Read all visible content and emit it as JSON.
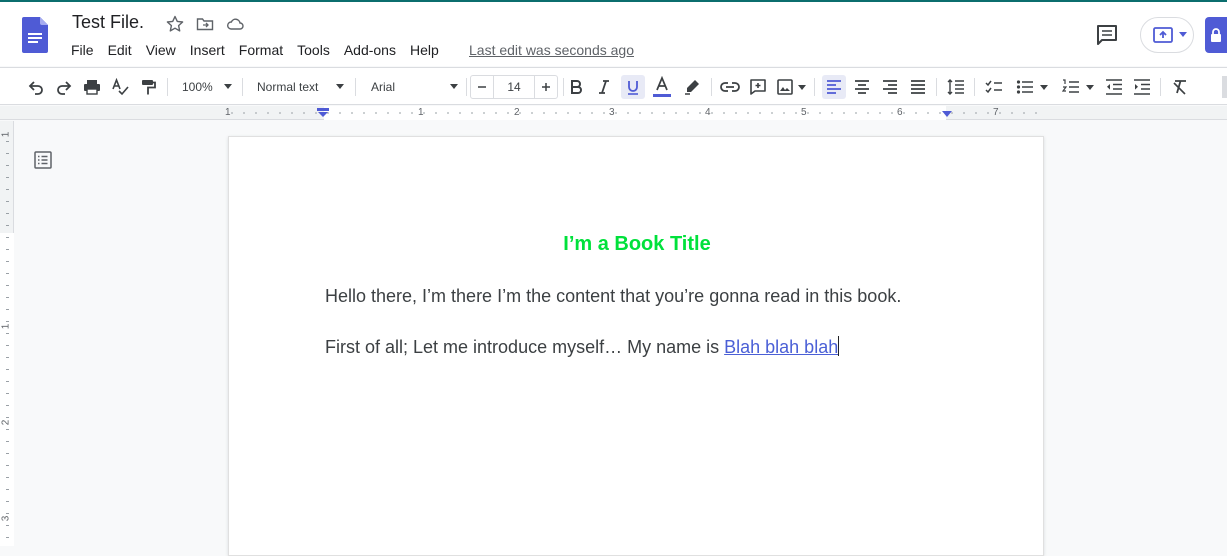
{
  "document": {
    "title": "Test File.",
    "last_edit": "Last edit was seconds ago",
    "book_title": "I’m a Book Title",
    "paragraph1": "Hello there, I’m there I’m the content that you’re gonna read in this book.",
    "paragraph2_text": "First of all; Let me introduce myself… My name is ",
    "paragraph2_link": "Blah blah blah"
  },
  "menu": [
    "File",
    "Edit",
    "View",
    "Insert",
    "Format",
    "Tools",
    "Add-ons",
    "Help"
  ],
  "toolbar": {
    "zoom": "100%",
    "style": "Normal text",
    "font": "Arial",
    "font_size": "14"
  },
  "ruler": {
    "numbers": [
      "1",
      "1",
      "2",
      "3",
      "4",
      "5",
      "6",
      "7"
    ]
  },
  "vruler": {
    "numbers": [
      "1",
      "1",
      "2",
      "3"
    ]
  },
  "colors": {
    "title_green": "#00e13b",
    "accent": "#4f5bd5",
    "link": "#4a5fd6"
  },
  "icons": [
    "docs-logo-icon",
    "star-icon",
    "move-folder-icon",
    "cloud-icon",
    "comment-icon",
    "present-icon",
    "undo-icon",
    "redo-icon",
    "print-icon",
    "spellcheck-icon",
    "paint-format-icon",
    "bold-icon",
    "italic-icon",
    "underline-icon",
    "text-color-icon",
    "highlight-icon",
    "link-icon",
    "add-comment-icon",
    "image-icon",
    "align-left-icon",
    "align-center-icon",
    "align-right-icon",
    "justify-icon",
    "line-spacing-icon",
    "checklist-icon",
    "bullet-list-icon",
    "numbered-list-icon",
    "decrease-indent-icon",
    "increase-indent-icon",
    "clear-format-icon",
    "outline-icon"
  ]
}
